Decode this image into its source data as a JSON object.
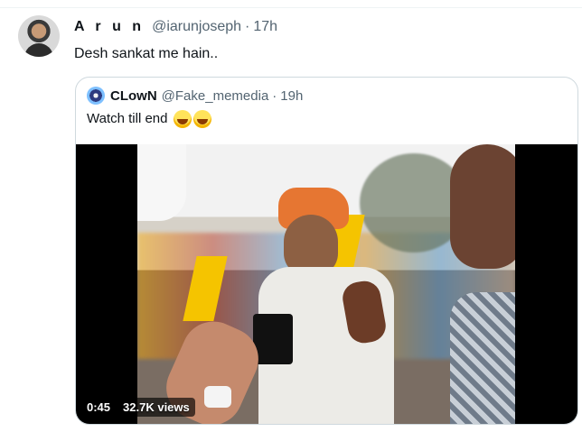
{
  "tweet": {
    "author_name": "A r u n",
    "handle": "@iarunjoseph",
    "separator": "·",
    "time": "17h",
    "text": "Desh sankat me hain.."
  },
  "quoted_tweet": {
    "author_name": "CLowN",
    "handle": "@Fake_memedia",
    "separator": "·",
    "time": "19h",
    "text": "Watch till end",
    "emojis": [
      "laughing-crying-face",
      "laughing-crying-face"
    ]
  },
  "video": {
    "duration": "0:45",
    "views": "32.7K views"
  }
}
